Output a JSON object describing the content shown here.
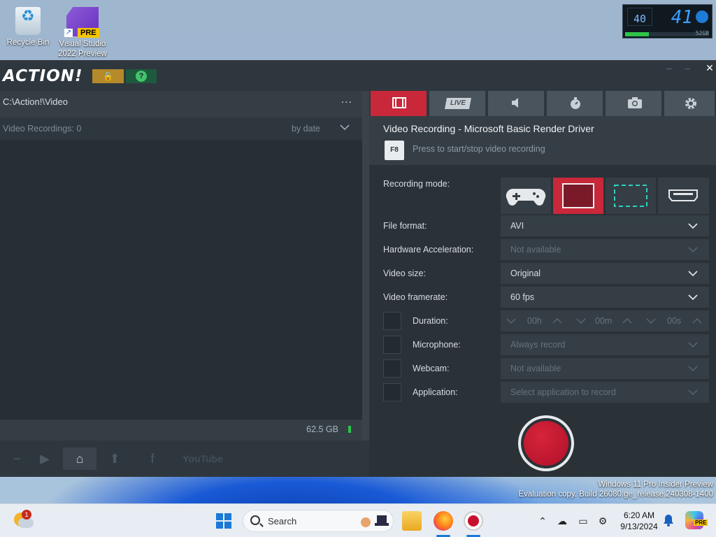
{
  "desktop": {
    "icons": [
      {
        "label": "Recycle Bin"
      },
      {
        "label": "Visual Studio 2022 Preview",
        "badge": "PRE"
      }
    ]
  },
  "hud": {
    "small_value": "40",
    "big_value": "41",
    "disk_label": "52GB",
    "disk_fill": 0.28
  },
  "app": {
    "logo": "ACTION!",
    "left": {
      "path": "C:\\Action!\\Video",
      "more": "...",
      "list_count": "Video Recordings: 0",
      "sort_label": "by date",
      "disk_space": "62.5 GB"
    },
    "toolbar": {
      "youtube": "YouTube"
    },
    "tabs": [
      {
        "name": "video-recording",
        "icon": "film-icon",
        "active": true
      },
      {
        "name": "live",
        "label": "LIVE"
      },
      {
        "name": "audio",
        "icon": "speaker-icon"
      },
      {
        "name": "benchmark",
        "icon": "stopwatch-icon"
      },
      {
        "name": "screenshot",
        "icon": "camera-icon"
      },
      {
        "name": "settings",
        "icon": "gear-icon"
      }
    ],
    "recording": {
      "title": "Video Recording - Microsoft Basic Render Driver",
      "hotkey": "F8",
      "hint": "Press to start/stop video recording",
      "mode_label": "Recording mode:",
      "modes": [
        "gamepad-icon",
        "fullscreen-icon",
        "area-icon",
        "hdmi-icon"
      ],
      "active_mode": 1,
      "file_format_label": "File format:",
      "file_format": "AVI",
      "hw_accel_label": "Hardware Acceleration:",
      "hw_accel": "Not available",
      "video_size_label": "Video size:",
      "video_size": "Original",
      "framerate_label": "Video framerate:",
      "framerate": "60 fps",
      "duration_label": "Duration:",
      "duration_h": "00h",
      "duration_m": "00m",
      "duration_s": "00s",
      "microphone_label": "Microphone:",
      "microphone": "Always record",
      "webcam_label": "Webcam:",
      "webcam": "Not available",
      "application_label": "Application:",
      "application": "Select application to record"
    }
  },
  "watermark": {
    "line1": "Windows 11 Pro Insider Preview",
    "line2": "Evaluation copy. Build 26080.ge_release.240308-1400"
  },
  "taskbar": {
    "weather_badge": "1",
    "search_placeholder": "Search",
    "time": "6:20 AM",
    "date": "9/13/2024",
    "copilot_badge": "PRE"
  }
}
